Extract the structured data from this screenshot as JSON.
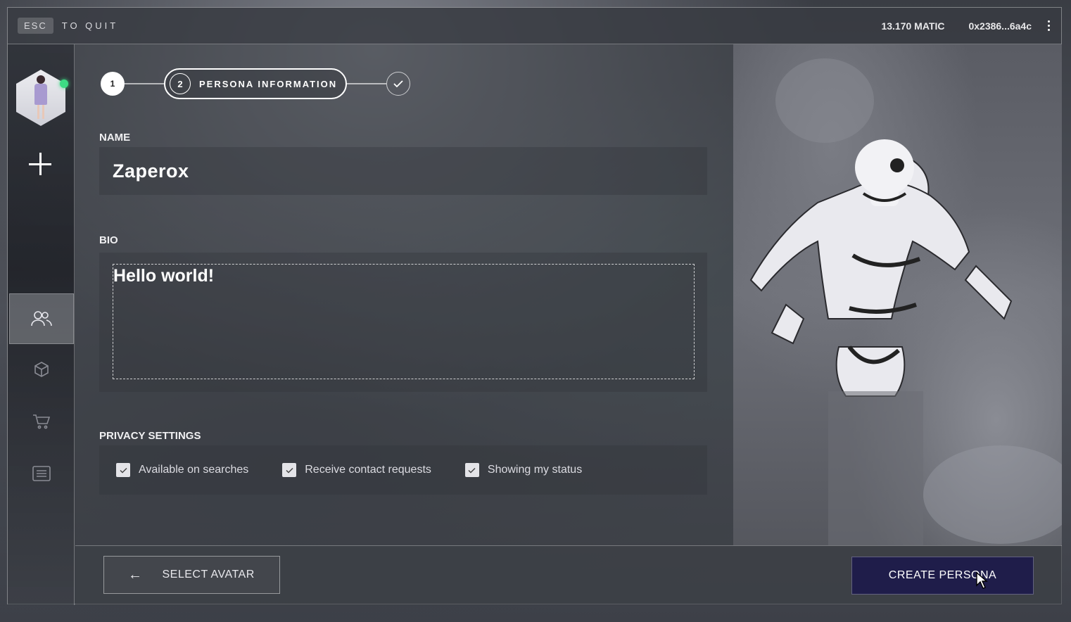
{
  "topbar": {
    "esc_key": "ESC",
    "quit_label": "TO  QUIT",
    "balance": "13.170 MATIC",
    "wallet": "0x2386...6a4c"
  },
  "sidebar": {
    "online_status_color": "#3ddc84",
    "nav_items": [
      {
        "icon": "users-icon",
        "active": true
      },
      {
        "icon": "cube-icon",
        "active": false
      },
      {
        "icon": "cart-icon",
        "active": false
      },
      {
        "icon": "list-icon",
        "active": false
      }
    ]
  },
  "stepper": {
    "step1_number": "1",
    "step2_number": "2",
    "step2_label": "PERSONA INFORMATION",
    "step3_icon": "check-icon"
  },
  "form": {
    "name_label": "NAME",
    "name_value": "Zaperox",
    "bio_label": "BIO",
    "bio_value": "Hello world!",
    "privacy_label": "PRIVACY SETTINGS",
    "privacy_options": [
      {
        "label": "Available on searches",
        "checked": true
      },
      {
        "label": "Receive contact requests",
        "checked": true
      },
      {
        "label": "Showing my status",
        "checked": true
      }
    ]
  },
  "footer": {
    "back_label": "SELECT AVATAR",
    "create_label": "CREATE PERSONA",
    "create_color": "#1f1d4a"
  }
}
